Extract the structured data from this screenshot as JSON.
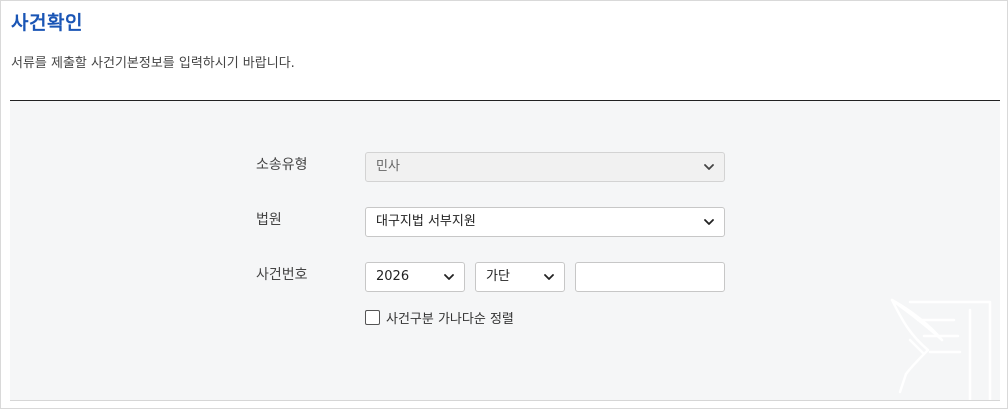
{
  "header": {
    "title": "사건확인",
    "description": "서류를 제출할 사건기본정보를 입력하시기 바랍니다."
  },
  "form": {
    "case_type": {
      "label": "소송유형",
      "value": "민사",
      "disabled": true
    },
    "court": {
      "label": "법원",
      "value": "대구지법 서부지원"
    },
    "case_number": {
      "label": "사건번호",
      "year": "2026",
      "type": "가단",
      "number_value": ""
    },
    "sort_checkbox": {
      "label": "사건구분 가나다순 정렬",
      "checked": false
    }
  },
  "colors": {
    "title": "#1a55b5",
    "panel_bg": "#f5f6f7",
    "rule": "#222222"
  },
  "icons": {
    "chevron": "chevron-down-icon",
    "decoration": "quill-document-icon"
  }
}
